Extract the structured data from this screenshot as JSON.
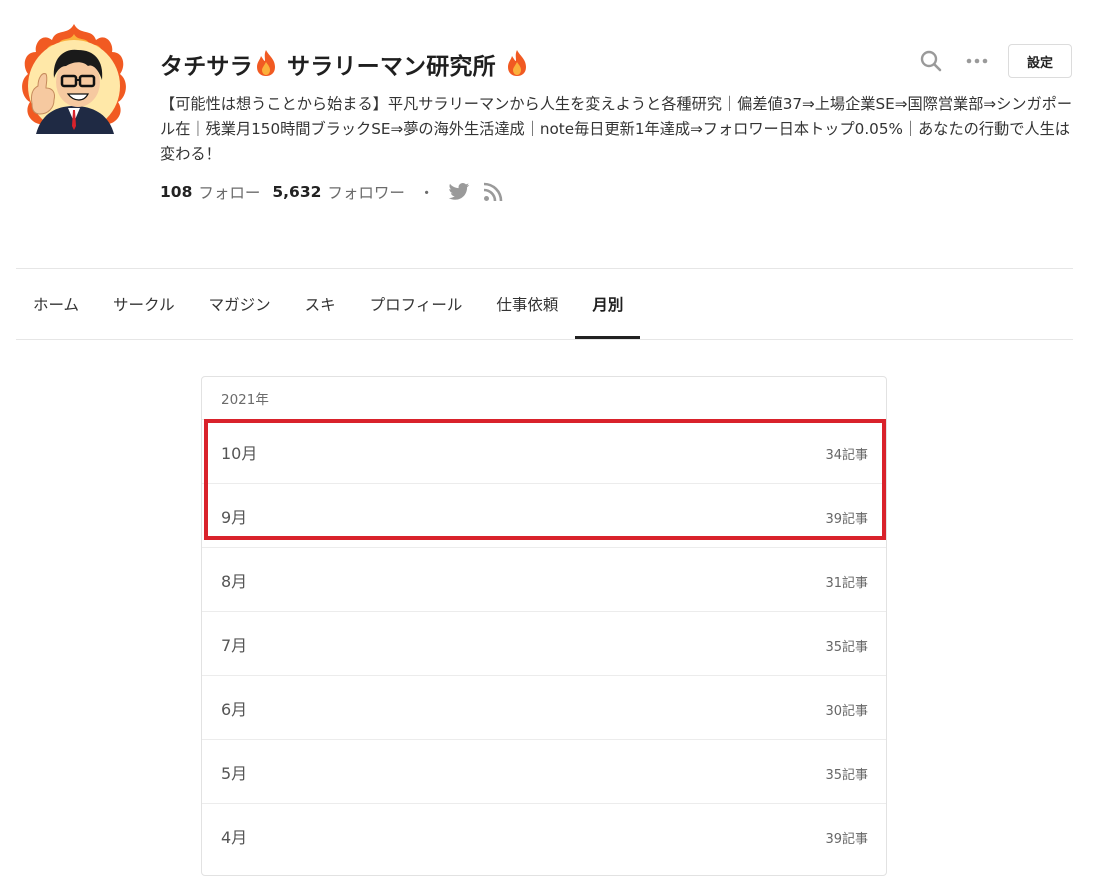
{
  "profile": {
    "name": "タチサラ",
    "name_suffix": "サラリーマン研究所",
    "bio": "【可能性は想うことから始まる】平凡サラリーマンから人生を変えようと各種研究｜偏差値37⇒上場企業SE⇒国際営業部⇒シンガポール在｜残業月150時間ブラックSE⇒夢の海外生活達成｜note毎日更新1年達成⇒フォロワー日本トップ0.05%｜あなたの行動で人生は変わる！",
    "follow_count": "108",
    "follow_label": "フォロー",
    "follower_count": "5,632",
    "follower_label": "フォロワー",
    "separator": "・"
  },
  "header": {
    "settings_label": "設定"
  },
  "tabs": [
    {
      "label": "ホーム"
    },
    {
      "label": "サークル"
    },
    {
      "label": "マガジン"
    },
    {
      "label": "スキ"
    },
    {
      "label": "プロフィール"
    },
    {
      "label": "仕事依頼"
    },
    {
      "label": "月別"
    }
  ],
  "archive": {
    "year": "2021年",
    "months": [
      {
        "month": "10月",
        "count": "34記事"
      },
      {
        "month": "9月",
        "count": "39記事"
      },
      {
        "month": "8月",
        "count": "31記事"
      },
      {
        "month": "7月",
        "count": "35記事"
      },
      {
        "month": "6月",
        "count": "30記事"
      },
      {
        "month": "5月",
        "count": "35記事"
      },
      {
        "month": "4月",
        "count": "39記事"
      }
    ]
  },
  "colors": {
    "highlight": "#d9222b",
    "flame": "#f15a22"
  }
}
